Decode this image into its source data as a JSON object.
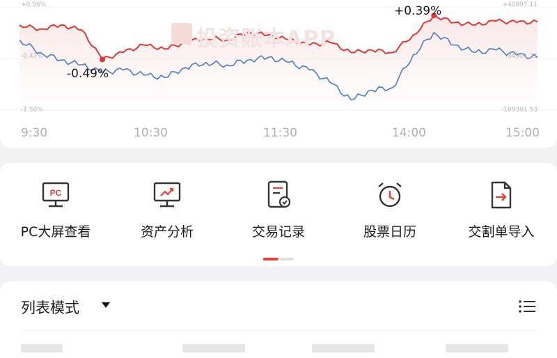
{
  "colors": {
    "portfolio_line": "#d93a35",
    "index_line": "#4a7cc4",
    "accent": "#e0413b"
  },
  "chart": {
    "left_axis": {
      "top": "+0.56%",
      "mid": "-0.47%",
      "bottom": "-1.50%"
    },
    "right_axis": {
      "top": "+40897.11",
      "mid": "-34901.21",
      "bottom": "-109301.53"
    },
    "time_labels": [
      "9:30",
      "10:30",
      "11:30",
      "14:00",
      "15:00"
    ],
    "high_label": "+0.39%",
    "low_label": "-0.49%",
    "watermark": "投资账本APP"
  },
  "chart_data": {
    "type": "line",
    "x": [
      "9:30",
      "9:40",
      "9:50",
      "10:00",
      "10:10",
      "10:20",
      "10:30",
      "10:40",
      "10:50",
      "11:00",
      "11:10",
      "11:20",
      "11:30",
      "13:00",
      "13:10",
      "13:20",
      "13:30",
      "13:40",
      "13:50",
      "14:00",
      "14:10",
      "14:20",
      "14:30",
      "14:40",
      "14:50",
      "15:00"
    ],
    "series": [
      {
        "values": [
          0.2,
          0.12,
          0.2,
          0.1,
          -0.49,
          -0.35,
          -0.2,
          -0.28,
          -0.15,
          -0.05,
          -0.1,
          0.05,
          0.0,
          -0.1,
          -0.2,
          -0.15,
          -0.35,
          -0.3,
          -0.35,
          0.0,
          0.39,
          0.25,
          0.2,
          0.28,
          0.25,
          0.26
        ]
      },
      {
        "values": [
          -0.1,
          -0.35,
          -0.5,
          -0.6,
          -0.75,
          -0.7,
          -0.8,
          -0.85,
          -0.65,
          -0.55,
          -0.6,
          -0.5,
          -0.45,
          -0.55,
          -0.7,
          -0.95,
          -1.3,
          -1.1,
          -1.05,
          -0.4,
          0.05,
          -0.2,
          -0.35,
          -0.3,
          -0.4,
          -0.45
        ]
      }
    ],
    "ylim": [
      -1.5,
      0.56
    ]
  },
  "tools": [
    {
      "label": "PC大屏查看",
      "icon": "pc-monitor-icon",
      "badge": "PC"
    },
    {
      "label": "资产分析",
      "icon": "trend-monitor-icon"
    },
    {
      "label": "交易记录",
      "icon": "document-check-icon"
    },
    {
      "label": "股票日历",
      "icon": "alarm-clock-icon"
    },
    {
      "label": "交割单导入",
      "icon": "import-file-icon"
    }
  ],
  "list": {
    "mode_label": "列表模式",
    "menu_icon": "list-menu-icon"
  }
}
